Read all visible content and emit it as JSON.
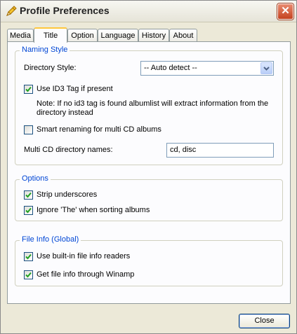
{
  "window": {
    "title": "Profile Preferences",
    "app_icon": "pencil-icon",
    "close_icon": "close-icon",
    "close_glyph": "✕"
  },
  "tabs": [
    {
      "label": "Media"
    },
    {
      "label": "Title",
      "active": true
    },
    {
      "label": "Option"
    },
    {
      "label": "Language"
    },
    {
      "label": "History"
    },
    {
      "label": "About"
    }
  ],
  "naming_style": {
    "title": "Naming Style",
    "directory_style_label": "Directory Style:",
    "directory_style_value": "-- Auto detect --",
    "use_id3": {
      "label": "Use ID3 Tag if present",
      "checked": true
    },
    "note": "Note: If no id3 tag is found albumlist will extract information from the directory instead",
    "smart_renaming": {
      "label": "Smart renaming for multi CD albums",
      "checked": false
    },
    "multi_cd_label": "Multi CD directory names:",
    "multi_cd_value": "cd, disc"
  },
  "options": {
    "title": "Options",
    "strip_underscores": {
      "label": "Strip underscores",
      "checked": true
    },
    "ignore_the": {
      "label": "Ignore 'The' when sorting albums",
      "checked": true
    }
  },
  "file_info": {
    "title": "File Info (Global)",
    "builtin_readers": {
      "label": "Use built-in file info readers",
      "checked": true
    },
    "winamp": {
      "label": "Get file info through Winamp",
      "checked": true
    }
  },
  "footer": {
    "close_label": "Close"
  },
  "colors": {
    "group_title": "#0046d5",
    "active_tab_accent": "#ffc73c",
    "check": "#21a121"
  }
}
